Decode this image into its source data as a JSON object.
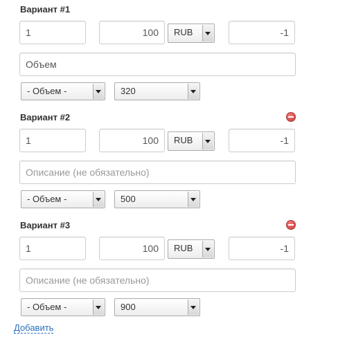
{
  "variants": [
    {
      "title": "Вариант #1",
      "has_remove": false,
      "quantity": "1",
      "price": "100",
      "currency": "RUB",
      "extra": "-1",
      "description": {
        "value": "Объем",
        "placeholder": ""
      },
      "param_select": "- Объем -",
      "value_select": "320"
    },
    {
      "title": "Вариант #2",
      "has_remove": true,
      "quantity": "1",
      "price": "100",
      "currency": "RUB",
      "extra": "-1",
      "description": {
        "value": "",
        "placeholder": "Описание (не обязательно)"
      },
      "param_select": "- Объем -",
      "value_select": "500"
    },
    {
      "title": "Вариант #3",
      "has_remove": true,
      "quantity": "1",
      "price": "100",
      "currency": "RUB",
      "extra": "-1",
      "description": {
        "value": "",
        "placeholder": "Описание (не обязательно)"
      },
      "param_select": "- Объем -",
      "value_select": "900"
    }
  ],
  "add_link": "Добавить"
}
